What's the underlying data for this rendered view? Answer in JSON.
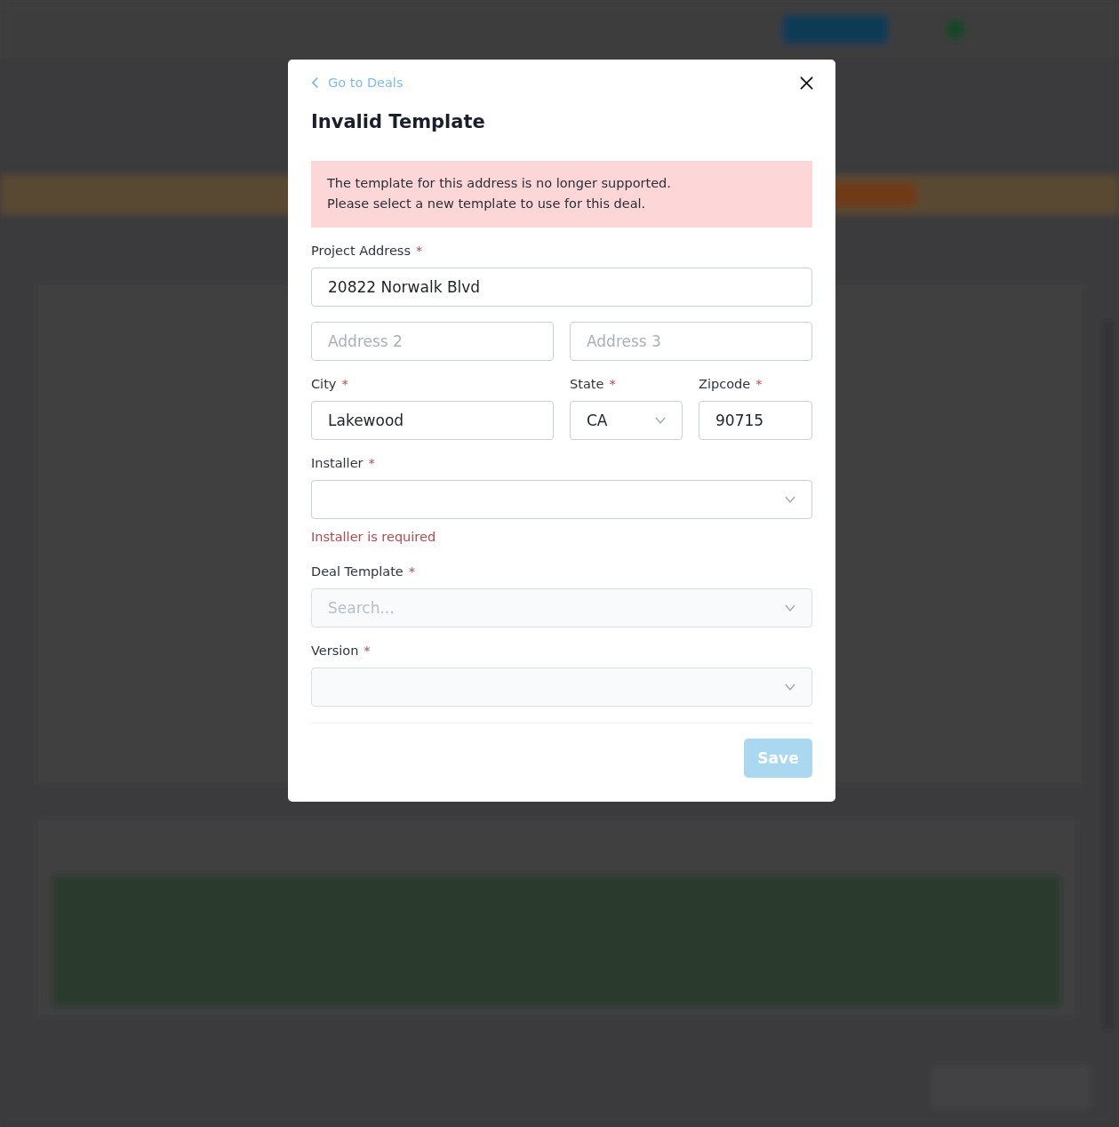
{
  "modal": {
    "back_link": "Go to Deals",
    "title": "Invalid Template",
    "alert": [
      "The template for this address is no longer supported.",
      "Please select a new template to use for this deal."
    ],
    "rows": [
      [
        {
          "kind": "text",
          "label": "Project Address",
          "required_mark": "*",
          "value": "20822 Norwalk Blvd",
          "disabled": false
        }
      ],
      [
        {
          "kind": "text",
          "placeholder": "Address 2",
          "disabled": false
        },
        {
          "kind": "text",
          "placeholder": "Address 3",
          "disabled": false
        }
      ],
      [
        {
          "kind": "text",
          "label": "City",
          "required_mark": "*",
          "value": "Lakewood",
          "disabled": false
        },
        {
          "kind": "select",
          "label": "State",
          "required_mark": "*",
          "value": "CA",
          "disabled": false
        },
        {
          "kind": "text",
          "label": "Zipcode",
          "required_mark": "*",
          "value": "90715",
          "disabled": false
        }
      ],
      [
        {
          "kind": "select",
          "label": "Installer",
          "required_mark": "*",
          "disabled": false,
          "error": "Installer is required"
        }
      ],
      [
        {
          "kind": "select",
          "label": "Deal Template",
          "required_mark": "*",
          "placeholder": "Search...",
          "disabled": true
        }
      ],
      [
        {
          "kind": "select",
          "label": "Version",
          "required_mark": "*",
          "disabled": true
        }
      ]
    ],
    "save_button": {
      "label": "Save",
      "disabled": true
    }
  }
}
